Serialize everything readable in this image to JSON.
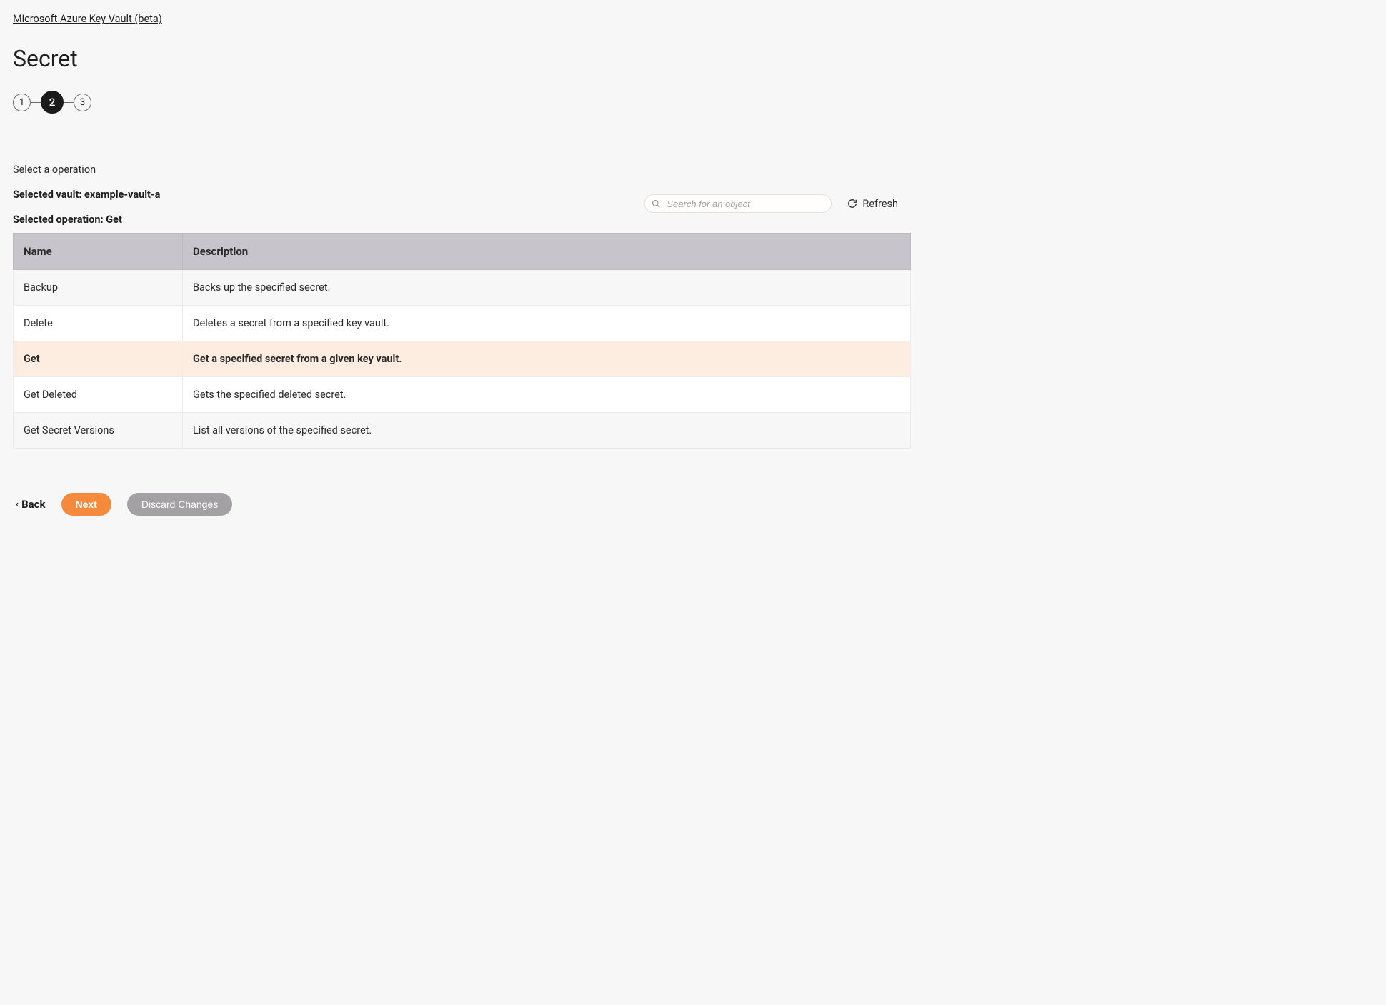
{
  "breadcrumb": "Microsoft Azure Key Vault (beta)",
  "page_title": "Secret",
  "stepper": {
    "steps": [
      "1",
      "2",
      "3"
    ],
    "active_index": 1
  },
  "prompt": "Select a operation",
  "selected_vault_line": "Selected vault: example-vault-a",
  "selected_operation_line": "Selected operation: Get",
  "search": {
    "placeholder": "Search for an object"
  },
  "refresh_label": "Refresh",
  "table": {
    "headers": [
      "Name",
      "Description"
    ],
    "rows": [
      {
        "name": "Backup",
        "description": "Backs up the specified secret.",
        "selected": false
      },
      {
        "name": "Delete",
        "description": "Deletes a secret from a specified key vault.",
        "selected": false
      },
      {
        "name": "Get",
        "description": "Get a specified secret from a given key vault.",
        "selected": true
      },
      {
        "name": "Get Deleted",
        "description": "Gets the specified deleted secret.",
        "selected": false
      },
      {
        "name": "Get Secret Versions",
        "description": "List all versions of the specified secret.",
        "selected": false
      }
    ]
  },
  "actions": {
    "back": "Back",
    "next": "Next",
    "discard": "Discard Changes"
  }
}
